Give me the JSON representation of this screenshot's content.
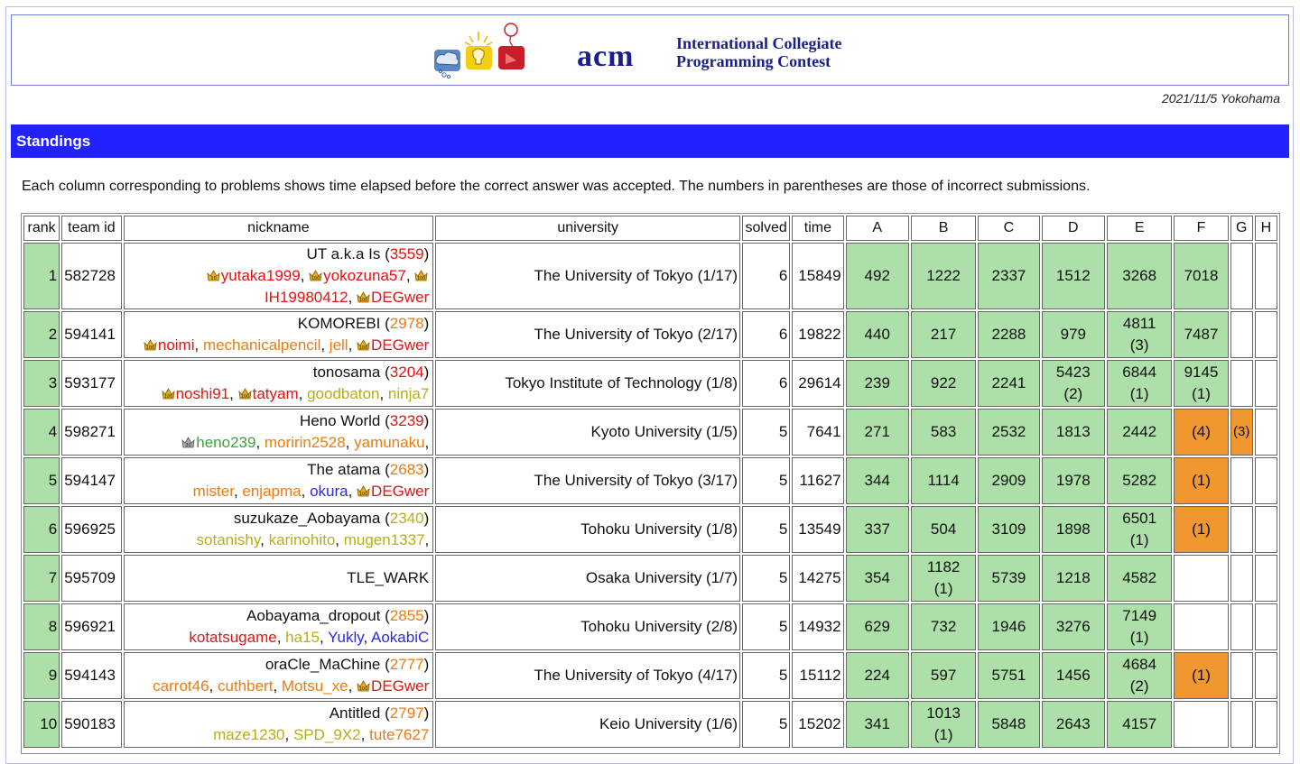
{
  "banner": {
    "acm": "acm",
    "icpc_line1": "International Collegiate",
    "icpc_line2": "Programming Contest"
  },
  "date_location": "2021/11/5 Yokohama",
  "section_title": "Standings",
  "description": "Each column corresponding to problems shows time elapsed before the correct answer was accepted. The numbers in parentheses are those of incorrect submissions.",
  "columns": [
    "rank",
    "team id",
    "nickname",
    "university",
    "solved",
    "time",
    "A",
    "B",
    "C",
    "D",
    "E",
    "F",
    "G",
    "H"
  ],
  "colors": {
    "accepted": "#ace0a8",
    "wrong": "#f0982f",
    "standings_bar": "#2222ff",
    "acm_blue": "#1a1f8f"
  },
  "rows": [
    {
      "rank": "1",
      "team_id": "582728",
      "team_name": "UT a.k.a Is",
      "rating": "3559",
      "rating_color": "red",
      "members": [
        {
          "name": "yutaka1999",
          "color": "red",
          "crown": "gold-10"
        },
        {
          "name": "yokozuna57",
          "color": "red",
          "crown": "gold-100"
        },
        {
          "name": "IH19980412",
          "color": "red",
          "crown": "gold-100"
        },
        {
          "name": "DEGwer",
          "color": "red",
          "crown": "gold-100"
        }
      ],
      "university": "The University of Tokyo (1/17)",
      "solved": "6",
      "time": "15849",
      "problems": [
        {
          "t": "492",
          "s": "ac"
        },
        {
          "t": "1222",
          "s": "ac"
        },
        {
          "t": "2337",
          "s": "ac"
        },
        {
          "t": "1512",
          "s": "ac"
        },
        {
          "t": "3268",
          "s": "ac"
        },
        {
          "t": "7018",
          "s": "ac"
        },
        {
          "t": "",
          "s": ""
        },
        {
          "t": "",
          "s": ""
        }
      ]
    },
    {
      "rank": "2",
      "team_id": "594141",
      "team_name": "KOMOREBI",
      "rating": "2978",
      "rating_color": "orange",
      "members": [
        {
          "name": "noimi",
          "color": "red",
          "crown": "gold-100"
        },
        {
          "name": "mechanicalpencil",
          "color": "orange",
          "crown": ""
        },
        {
          "name": "jell",
          "color": "orange",
          "crown": ""
        },
        {
          "name": "DEGwer",
          "color": "red",
          "crown": "gold-100"
        }
      ],
      "university": "The University of Tokyo (2/17)",
      "solved": "6",
      "time": "19822",
      "problems": [
        {
          "t": "440",
          "s": "ac"
        },
        {
          "t": "217",
          "s": "ac"
        },
        {
          "t": "2288",
          "s": "ac"
        },
        {
          "t": "979",
          "s": "ac"
        },
        {
          "t": "4811",
          "w": "(3)",
          "s": "ac"
        },
        {
          "t": "7487",
          "s": "ac"
        },
        {
          "t": "",
          "s": ""
        },
        {
          "t": "",
          "s": ""
        }
      ]
    },
    {
      "rank": "3",
      "team_id": "593177",
      "team_name": "tonosama",
      "rating": "3204",
      "rating_color": "red",
      "members": [
        {
          "name": "noshi91",
          "color": "red",
          "crown": "gold-100"
        },
        {
          "name": "tatyam",
          "color": "red",
          "crown": "gold-100"
        },
        {
          "name": "goodbaton",
          "color": "yellow",
          "crown": ""
        },
        {
          "name": "ninja7",
          "color": "yellow",
          "crown": ""
        }
      ],
      "university": "Tokyo Institute of Technology (1/8)",
      "solved": "6",
      "time": "29614",
      "problems": [
        {
          "t": "239",
          "s": "ac"
        },
        {
          "t": "922",
          "s": "ac"
        },
        {
          "t": "2241",
          "s": "ac"
        },
        {
          "t": "5423",
          "w": "(2)",
          "s": "ac"
        },
        {
          "t": "6844",
          "w": "(1)",
          "s": "ac"
        },
        {
          "t": "9145",
          "w": "(1)",
          "s": "ac"
        },
        {
          "t": "",
          "s": ""
        },
        {
          "t": "",
          "s": ""
        }
      ]
    },
    {
      "rank": "4",
      "team_id": "598271",
      "team_name": "Heno World",
      "rating": "3239",
      "rating_color": "red",
      "members": [
        {
          "name": "heno239",
          "color": "green",
          "crown": "silver-30"
        },
        {
          "name": "moririn2528",
          "color": "orange",
          "crown": ""
        },
        {
          "name": "yamunaku",
          "color": "orange",
          "crown": ""
        }
      ],
      "trailing_comma": true,
      "university": "Kyoto University (1/5)",
      "solved": "5",
      "time": "7641",
      "problems": [
        {
          "t": "271",
          "s": "ac"
        },
        {
          "t": "583",
          "s": "ac"
        },
        {
          "t": "2532",
          "s": "ac"
        },
        {
          "t": "1813",
          "s": "ac"
        },
        {
          "t": "2442",
          "s": "ac"
        },
        {
          "t": "(4)",
          "s": "wa"
        },
        {
          "t": "(3)",
          "s": "wa"
        },
        {
          "t": "",
          "s": ""
        }
      ]
    },
    {
      "rank": "5",
      "team_id": "594147",
      "team_name": "The atama",
      "rating": "2683",
      "rating_color": "orange",
      "members": [
        {
          "name": "mister",
          "color": "orange",
          "crown": ""
        },
        {
          "name": "enjapma",
          "color": "orange",
          "crown": ""
        },
        {
          "name": "okura",
          "color": "blue",
          "crown": ""
        },
        {
          "name": "DEGwer",
          "color": "red",
          "crown": "gold-100"
        }
      ],
      "university": "The University of Tokyo (3/17)",
      "solved": "5",
      "time": "11627",
      "problems": [
        {
          "t": "344",
          "s": "ac"
        },
        {
          "t": "1114",
          "s": "ac"
        },
        {
          "t": "2909",
          "s": "ac"
        },
        {
          "t": "1978",
          "s": "ac"
        },
        {
          "t": "5282",
          "s": "ac"
        },
        {
          "t": "(1)",
          "s": "wa"
        },
        {
          "t": "",
          "s": ""
        },
        {
          "t": "",
          "s": ""
        }
      ]
    },
    {
      "rank": "6",
      "team_id": "596925",
      "team_name": "suzukaze_Aobayama",
      "rating": "2340",
      "rating_color": "yellow",
      "members": [
        {
          "name": "sotanishy",
          "color": "yellow",
          "crown": ""
        },
        {
          "name": "karinohito",
          "color": "yellow",
          "crown": ""
        },
        {
          "name": "mugen1337",
          "color": "yellow",
          "crown": ""
        }
      ],
      "trailing_comma": true,
      "university": "Tohoku University (1/8)",
      "solved": "5",
      "time": "13549",
      "problems": [
        {
          "t": "337",
          "s": "ac"
        },
        {
          "t": "504",
          "s": "ac"
        },
        {
          "t": "3109",
          "s": "ac"
        },
        {
          "t": "1898",
          "s": "ac"
        },
        {
          "t": "6501",
          "w": "(1)",
          "s": "ac"
        },
        {
          "t": "(1)",
          "s": "wa"
        },
        {
          "t": "",
          "s": ""
        },
        {
          "t": "",
          "s": ""
        }
      ]
    },
    {
      "rank": "7",
      "team_id": "595709",
      "team_name": "TLE_WARK",
      "rating": "",
      "rating_color": "black",
      "members": [],
      "university": "Osaka University (1/7)",
      "solved": "5",
      "time": "14275",
      "problems": [
        {
          "t": "354",
          "s": "ac"
        },
        {
          "t": "1182",
          "w": "(1)",
          "s": "ac"
        },
        {
          "t": "5739",
          "s": "ac"
        },
        {
          "t": "1218",
          "s": "ac"
        },
        {
          "t": "4582",
          "s": "ac"
        },
        {
          "t": "",
          "s": ""
        },
        {
          "t": "",
          "s": ""
        },
        {
          "t": "",
          "s": ""
        }
      ]
    },
    {
      "rank": "8",
      "team_id": "596921",
      "team_name": "Aobayama_dropout",
      "rating": "2855",
      "rating_color": "orange",
      "members": [
        {
          "name": "kotatsugame",
          "color": "red",
          "crown": ""
        },
        {
          "name": "ha15",
          "color": "yellow",
          "crown": ""
        },
        {
          "name": "Yukly",
          "color": "blue",
          "crown": ""
        },
        {
          "name": "AokabiC",
          "color": "blue",
          "crown": ""
        }
      ],
      "university": "Tohoku University (2/8)",
      "solved": "5",
      "time": "14932",
      "problems": [
        {
          "t": "629",
          "s": "ac"
        },
        {
          "t": "732",
          "s": "ac"
        },
        {
          "t": "1946",
          "s": "ac"
        },
        {
          "t": "3276",
          "s": "ac"
        },
        {
          "t": "7149",
          "w": "(1)",
          "s": "ac"
        },
        {
          "t": "",
          "s": ""
        },
        {
          "t": "",
          "s": ""
        },
        {
          "t": "",
          "s": ""
        }
      ]
    },
    {
      "rank": "9",
      "team_id": "594143",
      "team_name": "oraCle_MaChine",
      "rating": "2777",
      "rating_color": "orange",
      "members": [
        {
          "name": "carrot46",
          "color": "orange",
          "crown": ""
        },
        {
          "name": "cuthbert",
          "color": "orange",
          "crown": ""
        },
        {
          "name": "Motsu_xe",
          "color": "orange",
          "crown": ""
        },
        {
          "name": "DEGwer",
          "color": "red",
          "crown": "gold-100"
        }
      ],
      "university": "The University of Tokyo (4/17)",
      "solved": "5",
      "time": "15112",
      "problems": [
        {
          "t": "224",
          "s": "ac"
        },
        {
          "t": "597",
          "s": "ac"
        },
        {
          "t": "5751",
          "s": "ac"
        },
        {
          "t": "1456",
          "s": "ac"
        },
        {
          "t": "4684",
          "w": "(2)",
          "s": "ac"
        },
        {
          "t": "(1)",
          "s": "wa"
        },
        {
          "t": "",
          "s": ""
        },
        {
          "t": "",
          "s": ""
        }
      ]
    },
    {
      "rank": "10",
      "team_id": "590183",
      "team_name": "Antitled",
      "rating": "2797",
      "rating_color": "orange",
      "members": [
        {
          "name": "maze1230",
          "color": "yellow",
          "crown": ""
        },
        {
          "name": "SPD_9X2",
          "color": "yellow",
          "crown": ""
        },
        {
          "name": "tute7627",
          "color": "orange",
          "crown": ""
        }
      ],
      "university": "Keio University (1/6)",
      "solved": "5",
      "time": "15202",
      "problems": [
        {
          "t": "341",
          "s": "ac"
        },
        {
          "t": "1013",
          "w": "(1)",
          "s": "ac"
        },
        {
          "t": "5848",
          "s": "ac"
        },
        {
          "t": "2643",
          "s": "ac"
        },
        {
          "t": "4157",
          "s": "ac"
        },
        {
          "t": "",
          "s": ""
        },
        {
          "t": "",
          "s": ""
        },
        {
          "t": "",
          "s": ""
        }
      ]
    }
  ]
}
